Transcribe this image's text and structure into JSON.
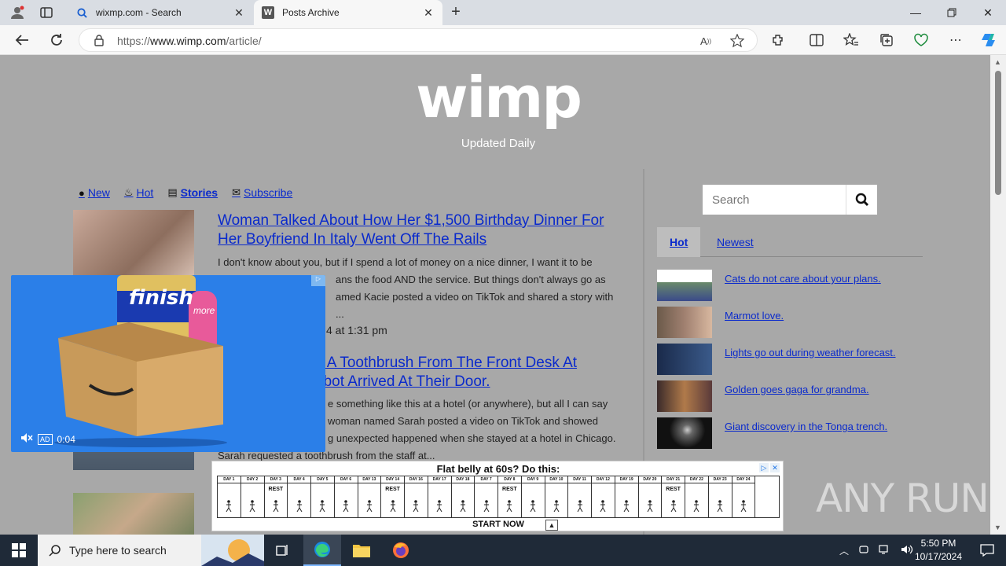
{
  "browser": {
    "tabs": [
      {
        "title": "wixmp.com - Search",
        "active": false
      },
      {
        "title": "Posts Archive",
        "active": true
      }
    ],
    "favicon_letter": "W",
    "url_prefix": "https://",
    "url_host": "www.wimp.com",
    "url_path": "/article/"
  },
  "site": {
    "logo": "wimp",
    "tagline": "Updated Daily"
  },
  "nav": [
    {
      "label": "New"
    },
    {
      "label": "Hot"
    },
    {
      "label": "Stories"
    },
    {
      "label": "Subscribe"
    }
  ],
  "articles": [
    {
      "title": "Woman Talked About How Her $1,500 Birthday Dinner For Her Boyfriend In Italy Went Off The Rails",
      "excerpt_lines": [
        "I don't know about you, but if I spend a lot of money on a nice dinner, I want it to be",
        "ans the food AND the service. But things don't always go as",
        "amed Kacie posted a video on TikTok and shared a story with",
        "..."
      ],
      "date": "4 at 1:31 pm"
    },
    {
      "title_lines": [
        "d A Toothbrush From The Front Desk At",
        "obot Arrived At Their Door."
      ],
      "excerpt_lines": [
        "e something like this at a hotel (or anywhere), but all I can say",
        "woman named Sarah posted a video on TikTok and showed",
        "g unexpected happened when she stayed at a hotel in Chicago.",
        "Sarah requested a toothbrush from the staff at..."
      ]
    }
  ],
  "sidebar": {
    "search_placeholder": "Search",
    "tabs": [
      {
        "label": "Hot",
        "active": true
      },
      {
        "label": "Newest",
        "active": false
      }
    ],
    "hot_items": [
      {
        "label": "Cats do not care about your plans."
      },
      {
        "label": "Marmot love."
      },
      {
        "label": "Lights go out during weather forecast."
      },
      {
        "label": "Golden goes gaga for grandma."
      },
      {
        "label": "Giant discovery in the Tonga trench."
      }
    ]
  },
  "video_ad": {
    "brand": "finish",
    "sub_brand": "more",
    "badge": "AD",
    "time": "0:04"
  },
  "banner_ad": {
    "headline": "Flat belly at 60s? Do this:",
    "cta": "START NOW",
    "days": [
      "DAY 1",
      "DAY 2",
      "DAY 3",
      "DAY 4",
      "DAY 5",
      "DAY 6",
      "DAY 13",
      "DAY 14",
      "DAY 16",
      "DAY 17",
      "DAY 18",
      "DAY 7",
      "DAY 8",
      "DAY 9",
      "DAY 10",
      "DAY 11",
      "DAY 12",
      "DAY 19",
      "DAY 20",
      "DAY 21",
      "DAY 22",
      "DAY 23",
      "DAY 24"
    ],
    "rest_days": [
      "DAY 3",
      "DAY 14",
      "DAY 8",
      "DAY 21"
    ]
  },
  "watermark": "ANY RUN",
  "taskbar": {
    "search_placeholder": "Type here to search",
    "time": "5:50 PM",
    "date": "10/17/2024"
  },
  "colors": {
    "link": "#0a2acc",
    "page_bg": "#a8a8a8",
    "ad_blue": "#2b7fe8",
    "taskbar": "#1f2a38"
  }
}
